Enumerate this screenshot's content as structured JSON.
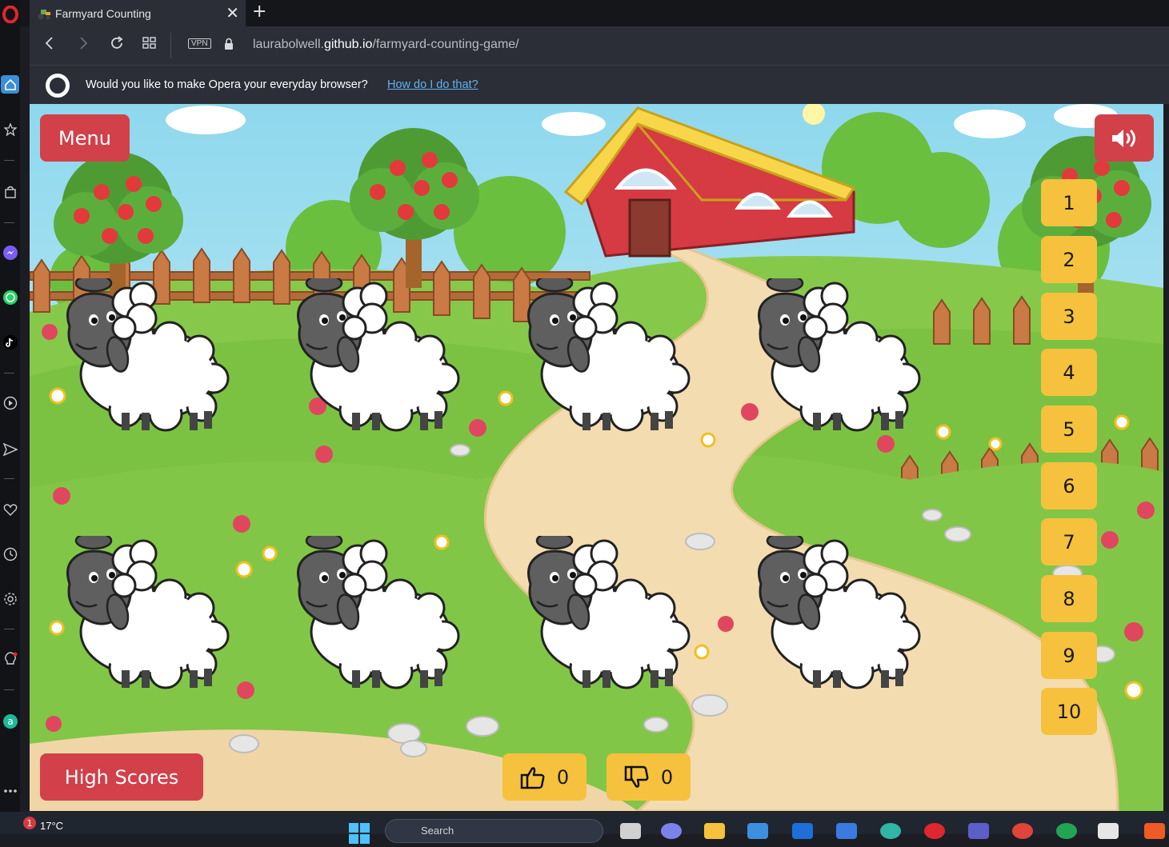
{
  "browser": {
    "tab_title": "Farmyard Counting",
    "tab_close_glyph": "✕",
    "new_tab_glyph": "+",
    "vpn_label": "VPN",
    "url_prefix": "laurabolwell.",
    "url_host": "github.io",
    "url_path": "/farmyard-counting-game/",
    "infobar_text": "Would you like to make Opera your everyday browser?",
    "infobar_link": "How do I do that?"
  },
  "game": {
    "menu_label": "Menu",
    "high_scores_label": "High Scores",
    "sound_icon": "volume-icon",
    "sheep_count": 8,
    "number_buttons": [
      "1",
      "2",
      "3",
      "4",
      "5",
      "6",
      "7",
      "8",
      "9",
      "10"
    ],
    "thumbs_up_count": "0",
    "thumbs_down_count": "0"
  },
  "taskbar": {
    "weather_badge": "1",
    "temperature": "17°C",
    "search_placeholder": "Search"
  },
  "colors": {
    "menu_red": "#d2404a",
    "number_yellow": "#f6c13d",
    "sky": "#a9e3f0",
    "grass": "#7cc242",
    "path": "#f3dcb0",
    "barn_red": "#d63a43",
    "barn_roof": "#f7d64a"
  }
}
